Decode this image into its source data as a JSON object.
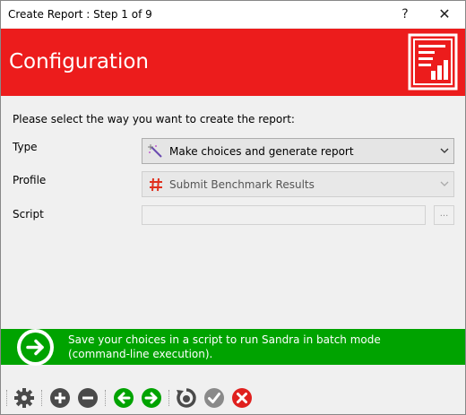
{
  "window": {
    "title": "Create Report : Step 1 of 9",
    "help_label": "?",
    "close_label": "✕"
  },
  "header": {
    "title": "Configuration",
    "background_color": "#ec1c1c"
  },
  "form": {
    "prompt": "Please select the way you want to create the report:",
    "type_label": "Type",
    "type_value": "Make choices and generate report",
    "profile_label": "Profile",
    "profile_value": "Submit Benchmark Results",
    "script_label": "Script",
    "script_value": "",
    "browse_label": "..."
  },
  "banner": {
    "text": "Save your choices in a script to run Sandra in batch mode (command-line execution).",
    "background_color": "#00a300"
  },
  "toolbar": {
    "icons": [
      "gear-icon",
      "add-icon",
      "remove-icon",
      "back-icon",
      "next-icon",
      "refresh-icon",
      "ok-icon",
      "cancel-icon"
    ]
  }
}
